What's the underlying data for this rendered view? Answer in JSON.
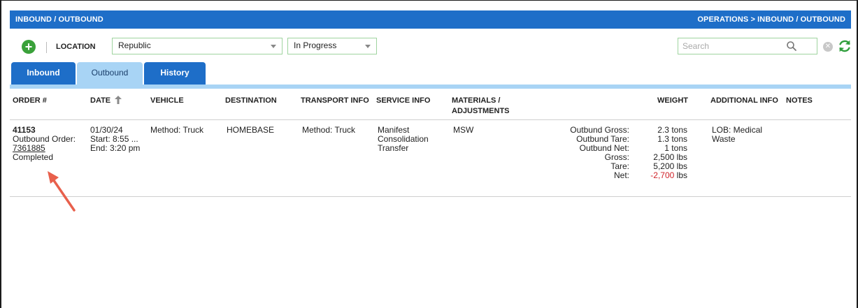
{
  "header": {
    "title": "INBOUND / OUTBOUND",
    "breadcrumb": "OPERATIONS > INBOUND / OUTBOUND"
  },
  "toolbar": {
    "add_icon": "plus-circle-icon",
    "location_label": "LOCATION",
    "location_value": "Republic",
    "status_value": "In Progress",
    "search_placeholder": "Search",
    "search_icon": "magnifier-icon",
    "clear_icon": "x-circle-icon",
    "refresh_icon": "refresh-icon",
    "accent_color": "#3aa13a"
  },
  "tabs": [
    {
      "label": "Inbound",
      "active": false
    },
    {
      "label": "Outbound",
      "active": true
    },
    {
      "label": "History",
      "active": false
    }
  ],
  "columns": {
    "order": "ORDER #",
    "date": "DATE",
    "vehicle": "VEHICLE",
    "destination": "DESTINATION",
    "transport": "TRANSPORT INFO",
    "service": "SERVICE INFO",
    "materials_1": "MATERIALS /",
    "materials_2": "ADJUSTMENTS",
    "weight": "WEIGHT",
    "additional": "ADDITIONAL INFO",
    "notes": "NOTES"
  },
  "row": {
    "order_number": "41153",
    "outbound_order_label": "Outbound Order:",
    "outbound_order_link": "7361885",
    "status": "Completed",
    "date": "01/30/24",
    "start": "Start: 8:55 ...",
    "end": "End: 3:20 pm",
    "vehicle": "Method: Truck",
    "destination": "HOMEBASE",
    "transport": "Method: Truck",
    "service_1": "Manifest",
    "service_2": "Consolidation",
    "service_3": "Transfer",
    "materials": "MSW",
    "weights": [
      {
        "label": "Outbund Gross:",
        "value": "2.3 tons",
        "negative": false
      },
      {
        "label": "Outbund Tare:",
        "value": "1.3 tons",
        "negative": false
      },
      {
        "label": "Outbund Net:",
        "value": "1 tons",
        "negative": false
      },
      {
        "label": "Gross:",
        "value": "2,500 lbs",
        "negative": false
      },
      {
        "label": "Tare:",
        "value": "5,200 lbs",
        "negative": false
      },
      {
        "label": "Net:",
        "value": "-2,700",
        "unit": "lbs",
        "negative": true
      }
    ],
    "additional_1": "LOB: Medical",
    "additional_2": "Waste"
  },
  "colors": {
    "header_blue": "#1e6ec8",
    "tab_light": "#a8d4f5",
    "negative_red": "#d0232a",
    "annotation_arrow": "#e8604c"
  }
}
